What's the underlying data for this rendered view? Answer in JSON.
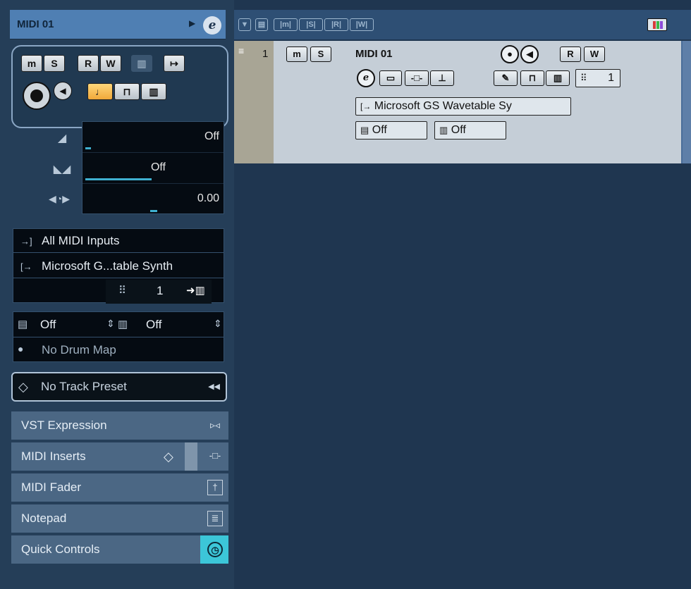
{
  "inspector": {
    "title": "MIDI 01",
    "title_arrow": "▶",
    "edit_button": "e",
    "buttons": {
      "mute": "m",
      "solo": "S",
      "read": "R",
      "write": "W",
      "monitor": "◀",
      "lock": "⊓",
      "lanes": "▥",
      "timebase": "♩",
      "output": "↦"
    },
    "volume": {
      "icon": "◢",
      "value": "Off"
    },
    "pan": {
      "icon": "◣◢",
      "value": "Off"
    },
    "delay": {
      "icon": "◀◔▶",
      "value": "0.00"
    },
    "routing": {
      "input_icon": "→]",
      "input": "All MIDI Inputs",
      "output_icon": "[→",
      "output": "Microsoft G...table Synth",
      "channel_icon": "⠿",
      "channel": "1",
      "edit_instrument_icon": "➜▥"
    },
    "maps": {
      "patch_icon": "▤",
      "patch_value": "Off",
      "bank_icon": "▥",
      "bank_value": "Off",
      "spin1": "⇕",
      "spin2": "⇕",
      "drum_icon": "●",
      "drum_map": "No Drum Map"
    },
    "preset": {
      "icon": "◇",
      "label": "No Track Preset",
      "arrow": "◀◀"
    },
    "sections": [
      {
        "label": "VST Expression",
        "icon": "▹◃"
      },
      {
        "label": "MIDI Inserts",
        "icon": "-□-"
      },
      {
        "label": "MIDI Fader",
        "icon": "†"
      },
      {
        "label": "Notepad",
        "icon": "≣"
      },
      {
        "label": "Quick Controls",
        "icon": "◷"
      }
    ],
    "inserts_diamond": "◇"
  },
  "toolbar": {
    "buttons": [
      "▼",
      "▤",
      "|m|",
      "|S|",
      "|R|",
      "|W|"
    ]
  },
  "track": {
    "number": "1",
    "name": "MIDI 01",
    "mute": "m",
    "solo": "S",
    "record": "●",
    "monitor": "◀",
    "read": "R",
    "write": "W",
    "edit": "e",
    "row2": [
      "▭",
      "-□-",
      "⊥",
      "✎",
      "⊓",
      "▥"
    ],
    "channel_icon": "⠿",
    "channel": "1",
    "output_icon": "[→",
    "output": "Microsoft GS Wavetable Sy",
    "patch_icon": "▤",
    "patch": "Off",
    "bank_icon": "▥",
    "bank": "Off"
  },
  "colors": {
    "background": "#1f3650",
    "accent": "#4f7fb3",
    "quick_controls": "#3cc6d8",
    "timebase_on": "#f0a83a"
  }
}
